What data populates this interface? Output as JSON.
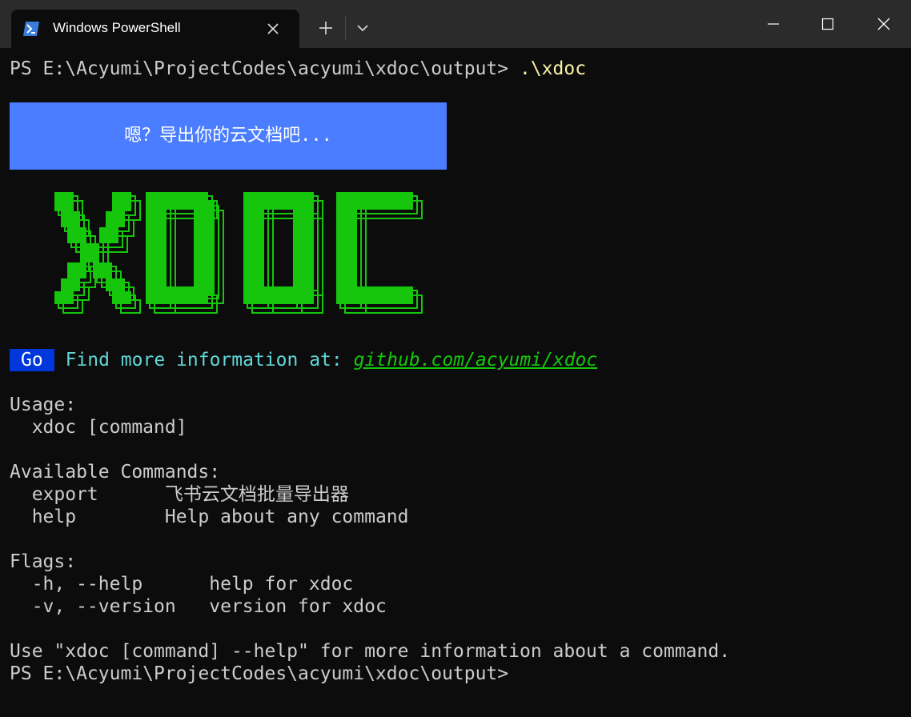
{
  "window": {
    "tab_title": "Windows PowerShell",
    "icons": {
      "tab_icon": "powershell-icon",
      "close_tab": "close-icon",
      "new_tab": "plus-icon",
      "dropdown": "chevron-down-icon",
      "minimize": "minimize-icon",
      "maximize": "maximize-icon",
      "close_window": "close-icon"
    }
  },
  "terminal": {
    "prompt": "PS E:\\Acyumi\\ProjectCodes\\acyumi\\xdoc\\output> ",
    "command": ".\\xdoc",
    "banner": "嗯？导出你的云文档吧...",
    "logo_text": "XDOC",
    "go_badge": "Go",
    "find_more": "Find more information at:",
    "link": "github.com/acyumi/xdoc",
    "usage_header": "Usage:",
    "usage_line": "  xdoc [command]",
    "commands_header": "Available Commands:",
    "commands": [
      "  export      飞书云文档批量导出器",
      "  help        Help about any command"
    ],
    "flags_header": "Flags:",
    "flags": [
      "  -h, --help      help for xdoc",
      "  -v, --version   version for xdoc"
    ],
    "footer": "Use \"xdoc [command] --help\" for more information about a command.",
    "final_prompt": "PS E:\\Acyumi\\ProjectCodes\\acyumi\\xdoc\\output>"
  },
  "colors": {
    "background": "#0c0c0c",
    "titlebar": "#2b2b2b",
    "foreground": "#cccccc",
    "command": "#f9f1a5",
    "banner": "#4a7dff",
    "logo_green": "#16c60c",
    "go_badge": "#0037da",
    "cyan": "#61d6d6"
  }
}
